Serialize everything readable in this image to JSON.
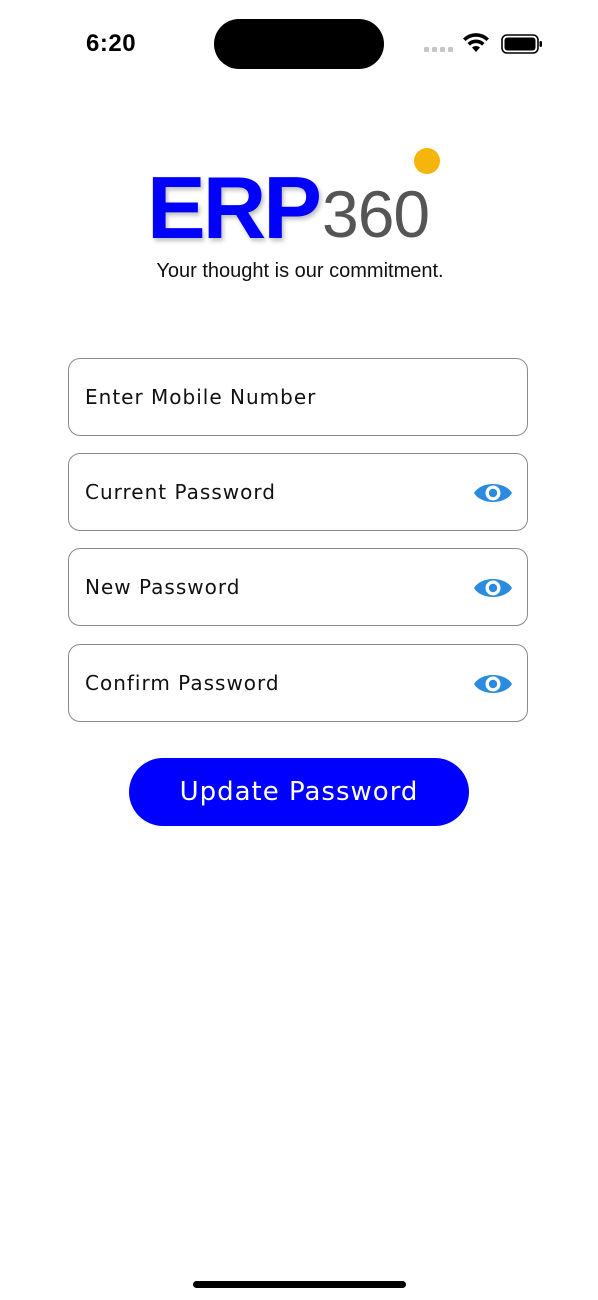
{
  "status_bar": {
    "time": "6:20"
  },
  "logo": {
    "brand_primary": "ERP",
    "brand_secondary": "360",
    "tagline": "Your thought is our commitment.",
    "colors": {
      "primary": "#0000ff",
      "secondary": "#555555",
      "dot": "#f5b50a"
    }
  },
  "form": {
    "mobile_placeholder": "Enter Mobile Number",
    "current_password_placeholder": "Current Password",
    "new_password_placeholder": "New Password",
    "confirm_password_placeholder": "Confirm Password",
    "visibility_icon": "eye-icon",
    "icon_color": "#2a8be0"
  },
  "actions": {
    "update_label": "Update Password",
    "button_color": "#0000ff"
  }
}
